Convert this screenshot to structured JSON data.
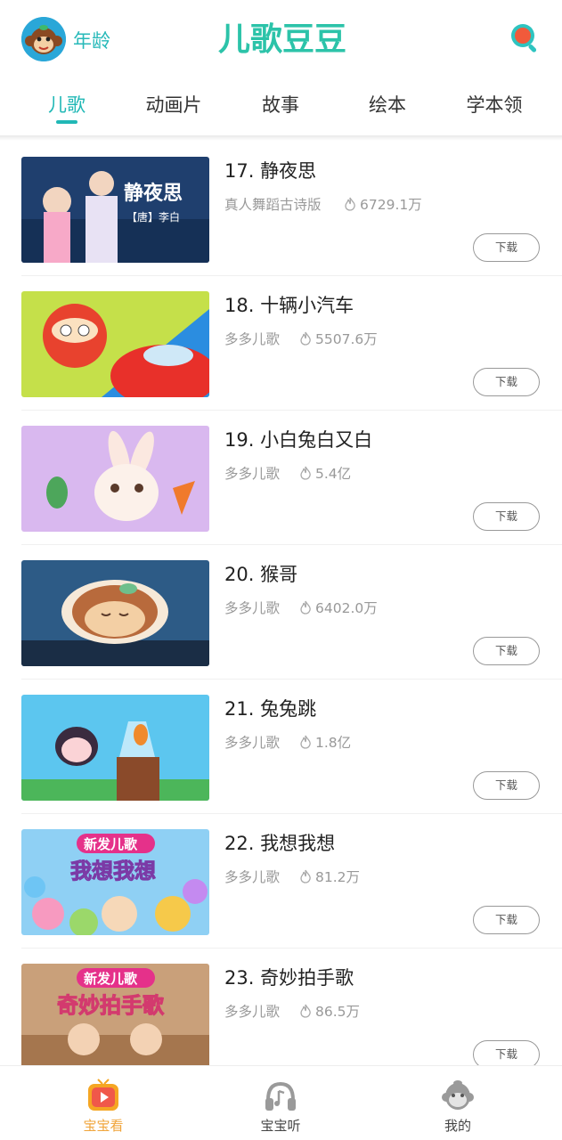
{
  "header": {
    "age_label": "年龄",
    "logo_text": "儿歌豆豆",
    "avatar_icon": "monkey-avatar-icon",
    "search_icon": "search-icon"
  },
  "tabs": [
    {
      "label": "儿歌",
      "active": true
    },
    {
      "label": "动画片",
      "active": false
    },
    {
      "label": "故事",
      "active": false
    },
    {
      "label": "绘本",
      "active": false
    },
    {
      "label": "学本领",
      "active": false
    }
  ],
  "items": [
    {
      "title": "17. 静夜思",
      "subtitle": "真人舞蹈古诗版",
      "plays": "6729.1万",
      "download": "下载",
      "thumb_text": "静夜思",
      "thumb_sub": "【唐】李白"
    },
    {
      "title": "18. 十辆小汽车",
      "subtitle": "多多儿歌",
      "plays": "5507.6万",
      "download": "下载"
    },
    {
      "title": "19. 小白兔白又白",
      "subtitle": "多多儿歌",
      "plays": "5.4亿",
      "download": "下载"
    },
    {
      "title": "20. 猴哥",
      "subtitle": "多多儿歌",
      "plays": "6402.0万",
      "download": "下载"
    },
    {
      "title": "21. 兔兔跳",
      "subtitle": "多多儿歌",
      "plays": "1.8亿",
      "download": "下载"
    },
    {
      "title": "22. 我想我想",
      "subtitle": "多多儿歌",
      "plays": "81.2万",
      "download": "下载",
      "thumb_badge": "新发儿歌",
      "thumb_text": "我想我想"
    },
    {
      "title": "23. 奇妙拍手歌",
      "subtitle": "多多儿歌",
      "plays": "86.5万",
      "download": "下载",
      "thumb_badge": "新发儿歌",
      "thumb_text": "奇妙拍手歌"
    }
  ],
  "bottom_nav": [
    {
      "label": "宝宝看",
      "icon": "play-tv-icon",
      "active": true
    },
    {
      "label": "宝宝听",
      "icon": "headphones-icon",
      "active": false
    },
    {
      "label": "我的",
      "icon": "monkey-profile-icon",
      "active": false
    }
  ],
  "colors": {
    "accent": "#21b8b6",
    "active_nav": "#f0a43a"
  }
}
